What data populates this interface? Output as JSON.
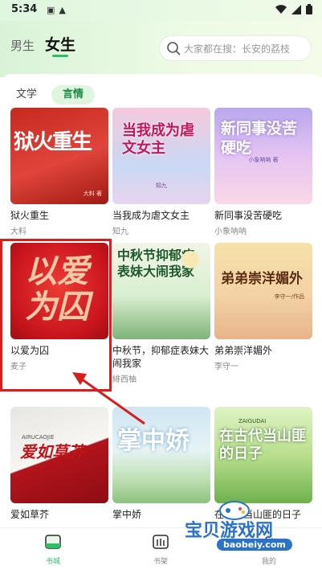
{
  "status": {
    "time": "5:34"
  },
  "header": {
    "gender_tabs": [
      "男生",
      "女生"
    ],
    "search_placeholder": "大家都在搜：长安的荔枝"
  },
  "sub_tabs": [
    "文学",
    "言情"
  ],
  "books": [
    {
      "title": "狱火重生",
      "author": "大料",
      "cover_text": "狱火重生",
      "cover_sub": "大料 著"
    },
    {
      "title": "当我成为虐文女主",
      "author": "知九",
      "cover_text": "当我成为虐文女主",
      "cover_sub": "知九"
    },
    {
      "title": "新同事没苦硬吃",
      "author": "小象呐呐",
      "cover_text": "新同事没苦硬吃",
      "cover_sub": "小象呐呐 著"
    },
    {
      "title": "以爱为囚",
      "author": "麦子",
      "cover_text": "以爱为囚",
      "cover_sub": ""
    },
    {
      "title": "中秋节，抑郁症表妹大闹我家",
      "author": "緋西柚",
      "cover_text": "中秋节抑郁症表妹大闹我家",
      "cover_sub": ""
    },
    {
      "title": "弟弟崇洋媚外",
      "author": "李守一",
      "cover_text": "弟弟崇洋媚外",
      "cover_sub": "李守一/作品"
    },
    {
      "title": "爱如草芥",
      "author": "",
      "cover_text": "爱如草芥",
      "cover_sub": "AIRUCAOJIE"
    },
    {
      "title": "掌中娇",
      "author": "",
      "cover_text": "掌中娇",
      "cover_sub": ""
    },
    {
      "title": "在古代当山匪的日子",
      "author": "",
      "cover_text": "在古代当山匪的日子",
      "cover_sub": "ZAIGUDAI"
    }
  ],
  "bottom_nav": [
    {
      "label": "书城",
      "icon": "bookstore-icon"
    },
    {
      "label": "书架",
      "icon": "bookshelf-icon"
    },
    {
      "label": "我的",
      "icon": "profile-icon"
    }
  ],
  "watermark": {
    "main": "宝贝游戏网",
    "url": "baobeiy.com"
  },
  "colors": {
    "accent": "#2bbf6a",
    "highlight": "#d91c1c"
  }
}
